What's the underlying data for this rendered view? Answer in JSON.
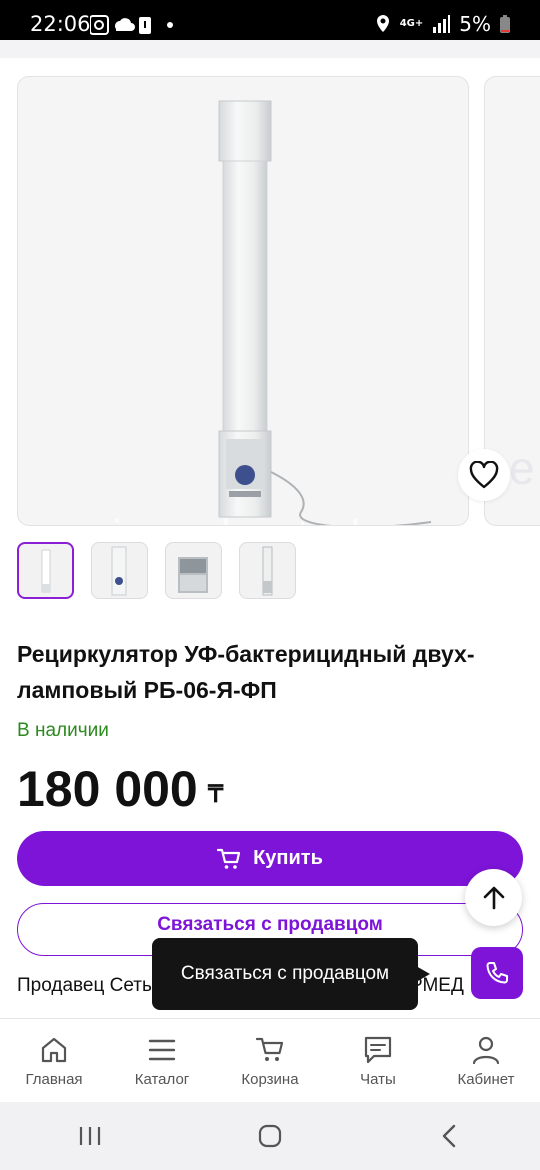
{
  "status_bar": {
    "time": "22:06",
    "battery": "5%",
    "network": "4G+"
  },
  "product": {
    "watermark": "emirmed.satu.kz",
    "watermark_partial": "e",
    "title": "Рециркулятор УФ-бактерицидный двух-ламповый РБ-06-Я-ФП",
    "stock": "В наличии",
    "price": "180 000",
    "currency": "₸"
  },
  "actions": {
    "buy_label": "Купить",
    "contact_label": "Связаться с продавцом"
  },
  "seller": {
    "prefix": "Продавец Сеть",
    "suffix": "РМЕД"
  },
  "tooltip": {
    "text": "Связаться с продавцом"
  },
  "bottom_nav": {
    "items": [
      {
        "label": "Главная",
        "icon": "home-icon"
      },
      {
        "label": "Каталог",
        "icon": "menu-icon"
      },
      {
        "label": "Корзина",
        "icon": "cart-icon"
      },
      {
        "label": "Чаты",
        "icon": "chat-icon"
      },
      {
        "label": "Кабинет",
        "icon": "user-icon"
      }
    ]
  },
  "colors": {
    "accent": "#7d14d8",
    "stock": "#2c8a1e"
  }
}
